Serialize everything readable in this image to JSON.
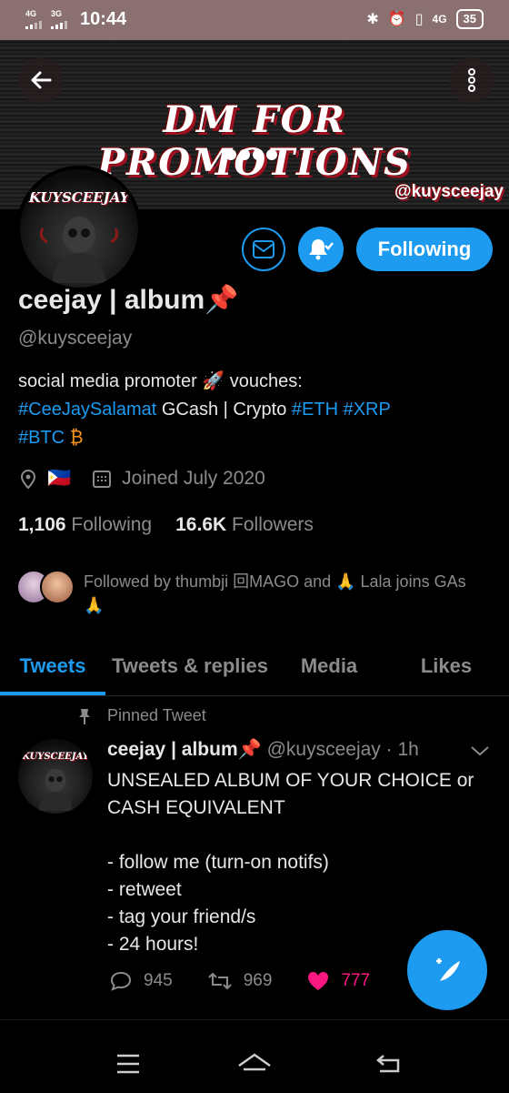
{
  "status_bar": {
    "sim1": "4G",
    "sim2": "3G",
    "time": "10:44",
    "net": "4G",
    "battery": "35"
  },
  "header": {
    "banner_title": "DM FOR PROMOTIONS",
    "banner_handle": "@kuysceejay",
    "avatar_brand": "KUYSCEEJAY"
  },
  "actions": {
    "following_label": "Following"
  },
  "profile": {
    "name": "ceejay | album📌",
    "handle": "@kuysceejay",
    "bio_1": "social media promoter 🚀 vouches:",
    "bio_tag1": "#CeeJaySalamat",
    "bio_mid": " GCash | Crypto ",
    "bio_tag2": "#ETH",
    "bio_tag3": "#XRP",
    "bio_tag4": "#BTC",
    "bio_btc": "₿",
    "flag": "🇵🇭",
    "joined": "Joined July 2020",
    "following_count": "1,106",
    "following_label": "Following",
    "followers_count": "16.6K",
    "followers_label": "Followers",
    "followed_by": "Followed by thumbji 回MAGO and 🙏 Lala joins GAs 🙏"
  },
  "tabs": [
    "Tweets",
    "Tweets & replies",
    "Media",
    "Likes"
  ],
  "tweet": {
    "pinned_label": "Pinned Tweet",
    "author": "ceejay | album📌",
    "handle_time": "@kuysceejay · 1h",
    "text": "UNSEALED ALBUM OF YOUR CHOICE or CASH EQUIVALENT\n\n- follow me (turn-on notifs)\n- retweet\n- tag your friend/s\n- 24 hours!",
    "replies": "945",
    "retweets": "969",
    "likes": "777"
  },
  "colors": {
    "accent": "#1d9bf0",
    "like": "#f91880",
    "status_bar": "#8a7070"
  },
  "icons": [
    "back-arrow-icon",
    "more-vertical-icon",
    "mail-icon",
    "bell-check-icon",
    "location-icon",
    "calendar-icon",
    "pin-icon",
    "chevron-down-icon",
    "reply-icon",
    "retweet-icon",
    "heart-icon",
    "compose-icon",
    "menu-icon",
    "home-icon",
    "back-icon"
  ]
}
